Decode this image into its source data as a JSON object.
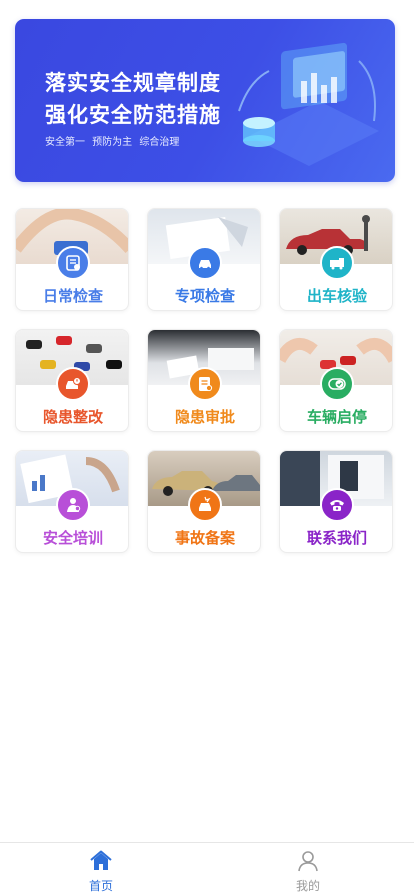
{
  "banner": {
    "title_line1": "落实安全规章制度",
    "title_line2": "强化安全防范措施",
    "subtitle": "安全第一  预防为主  综合治理"
  },
  "tiles": [
    {
      "label": "日常检查",
      "icon": "checklist-icon",
      "color": "#4a7ee8"
    },
    {
      "label": "专项检查",
      "icon": "car-icon",
      "color": "#3a7ae6"
    },
    {
      "label": "出车核验",
      "icon": "truck-icon",
      "color": "#1fb4c8"
    },
    {
      "label": "隐患整改",
      "icon": "car-alert-icon",
      "color": "#e8562c"
    },
    {
      "label": "隐患审批",
      "icon": "document-approve-icon",
      "color": "#f08a1c"
    },
    {
      "label": "车辆启停",
      "icon": "toggle-check-icon",
      "color": "#29ad62"
    },
    {
      "label": "安全培训",
      "icon": "trainer-icon",
      "color": "#b84fd8"
    },
    {
      "label": "事故备案",
      "icon": "car-accident-icon",
      "color": "#f07516"
    },
    {
      "label": "联系我们",
      "icon": "telephone-icon",
      "color": "#8a24c8"
    }
  ],
  "tabbar": {
    "home_label": "首页",
    "home_color": "#2d6fd9",
    "mine_label": "我的",
    "mine_color": "#9a9a9a"
  }
}
